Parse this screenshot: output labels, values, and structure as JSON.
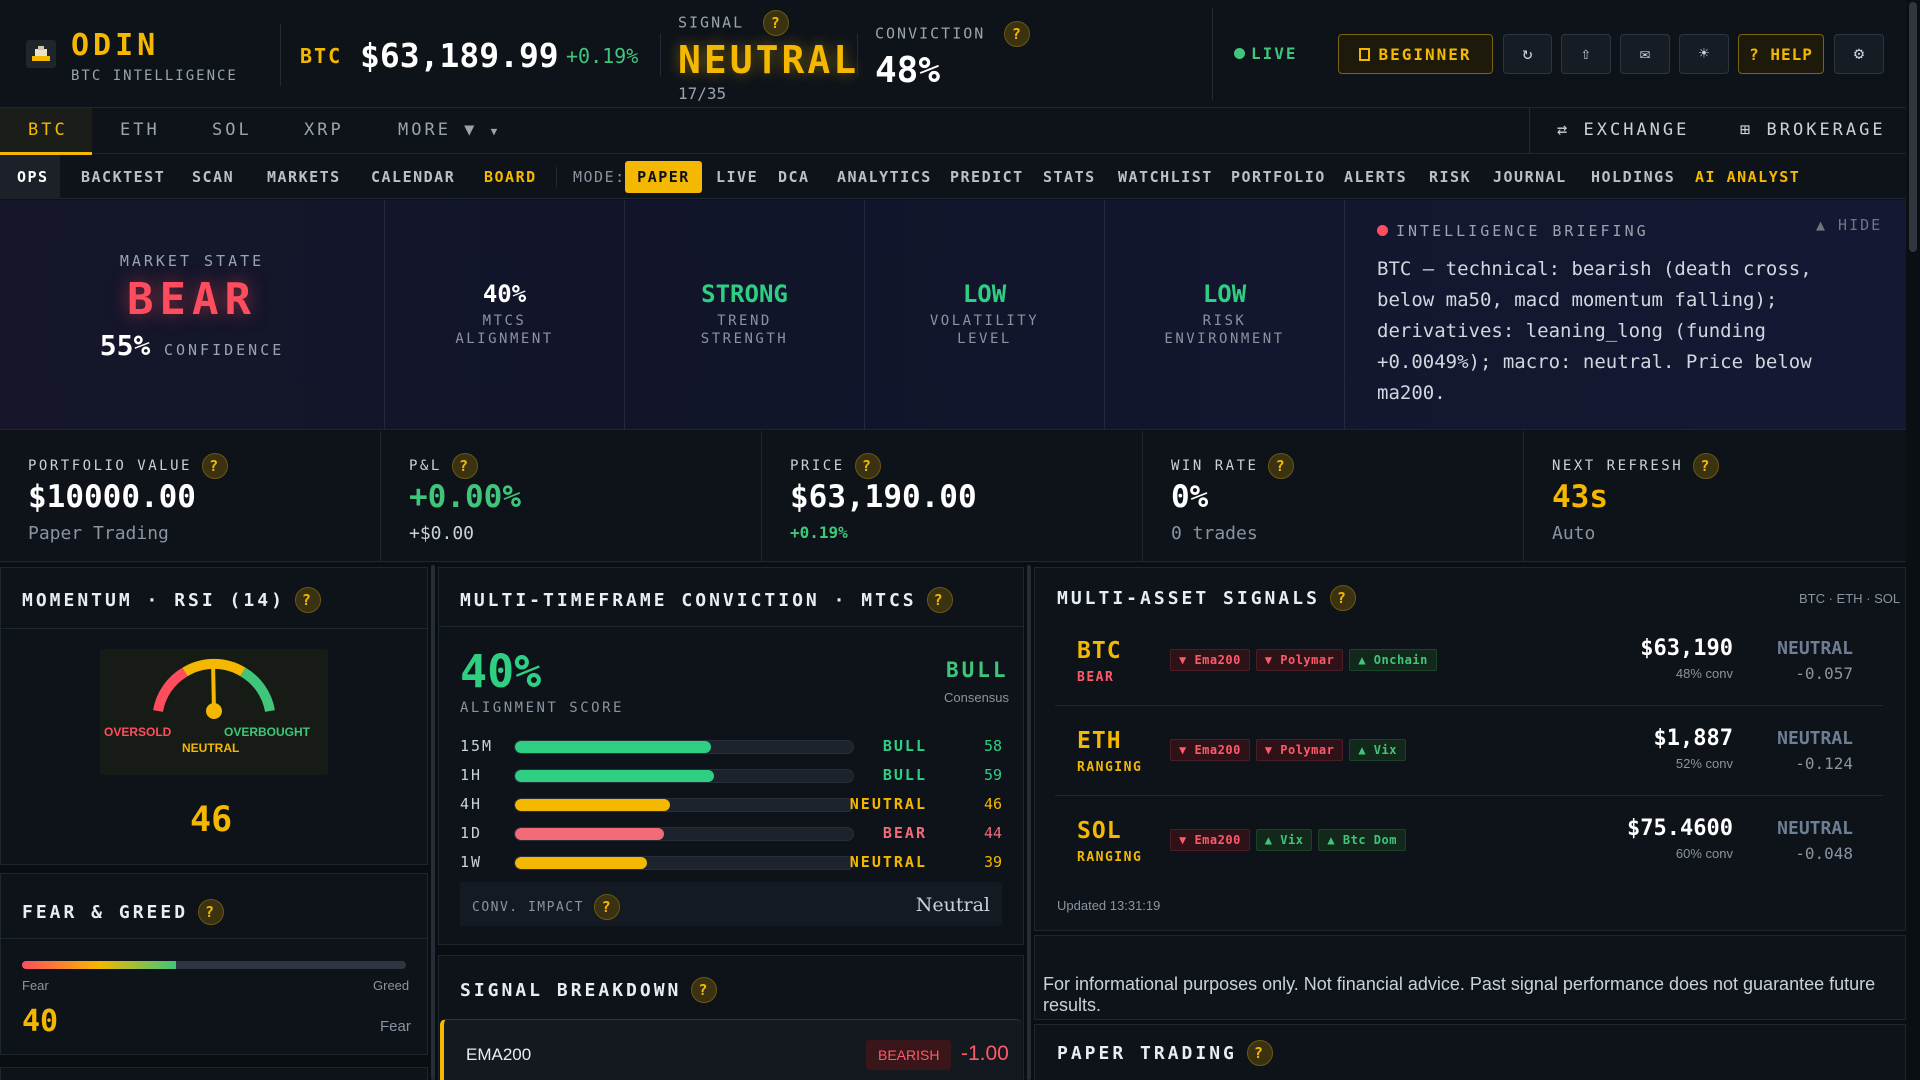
{
  "header": {
    "app_name": "ODIN",
    "app_sub": "BTC INTELLIGENCE",
    "ticker": "BTC",
    "price": "$63,189.99",
    "change": "+0.19%",
    "signal_label": "SIGNAL",
    "signal_value": "NEUTRAL",
    "signal_count": "17/35",
    "conviction_label": "CONVICTION",
    "conviction_value": "48%",
    "live_label": "LIVE",
    "beginner_label": "BEGINNER",
    "help_label": "? HELP",
    "help_q": "?",
    "icons": [
      "refresh-icon",
      "share-icon",
      "mail-icon",
      "theme-icon",
      "gear-icon"
    ]
  },
  "asset_tabs": [
    "BTC",
    "ETH",
    "SOL",
    "XRP",
    "MORE ▼"
  ],
  "right_links": {
    "exchange": "EXCHANGE",
    "brokerage": "BROKERAGE"
  },
  "nav": {
    "items_left": [
      "OPS",
      "BACKTEST",
      "SCAN",
      "MARKETS",
      "CALENDAR",
      "BOARD"
    ],
    "mode_label": "MODE:",
    "mode_active": "PAPER",
    "items_right": [
      "LIVE",
      "DCA",
      "ANALYTICS",
      "PREDICT",
      "STATS",
      "WATCHLIST",
      "PORTFOLIO",
      "ALERTS",
      "RISK",
      "JOURNAL",
      "HOLDINGS",
      "AI ANALYST"
    ]
  },
  "market_state": {
    "label": "MARKET STATE",
    "value": "BEAR",
    "confidence_value": "55%",
    "confidence_label": "CONFIDENCE",
    "metrics": [
      {
        "value": "40%",
        "l1": "MTCS",
        "l2": "ALIGNMENT",
        "color": "#ffffff"
      },
      {
        "value": "STRONG",
        "l1": "TREND",
        "l2": "STRENGTH",
        "color": "#2ecf83"
      },
      {
        "value": "LOW",
        "l1": "VOLATILITY",
        "l2": "LEVEL",
        "color": "#2ecf83"
      },
      {
        "value": "LOW",
        "l1": "RISK",
        "l2": "ENVIRONMENT",
        "color": "#2ecf83"
      }
    ]
  },
  "briefing": {
    "title": "INTELLIGENCE BRIEFING",
    "hide": "▲ HIDE",
    "text": "BTC — technical: bearish (death cross, below ma50, macd momentum falling); derivatives: leaning_long (funding +0.0049%); macro: neutral. Price below ma200."
  },
  "stats": [
    {
      "label": "PORTFOLIO VALUE",
      "value": "$10000.00",
      "sub": "Paper Trading",
      "value_color": "#ffffff",
      "sub_color": "#8a93a0"
    },
    {
      "label": "P&L",
      "value": "+0.00%",
      "sub": "+$0.00",
      "value_color": "#3fc67a",
      "sub_color": "#c9d1d9"
    },
    {
      "label": "PRICE",
      "value": "$63,190.00",
      "sub": "+0.19%",
      "value_color": "#ffffff",
      "sub_color": "#3fc67a"
    },
    {
      "label": "WIN RATE",
      "value": "0%",
      "sub": "0 trades",
      "value_color": "#ffffff",
      "sub_color": "#8a93a0"
    },
    {
      "label": "NEXT REFRESH",
      "value": "43s",
      "sub": "Auto",
      "value_color": "#f5b800",
      "sub_color": "#8a93a0"
    }
  ],
  "rsi": {
    "title": "MOMENTUM · RSI (14)",
    "value": "46",
    "oversold": "OVERSOLD",
    "overbought": "OVERBOUGHT",
    "neutral": "NEUTRAL"
  },
  "fear_greed": {
    "title": "FEAR & GREED",
    "fear": "Fear",
    "greed": "Greed",
    "value": "40",
    "state": "Fear",
    "level": 40
  },
  "mtcs": {
    "title": "MULTI-TIMEFRAME CONVICTION · MTCS",
    "score": "40%",
    "score_label": "ALIGNMENT SCORE",
    "consensus_value": "BULL",
    "consensus_label": "Consensus",
    "rows": [
      {
        "tf": "15M",
        "state": "BULL",
        "value": 58,
        "color": "#2ecf83"
      },
      {
        "tf": "1H",
        "state": "BULL",
        "value": 59,
        "color": "#2ecf83"
      },
      {
        "tf": "4H",
        "state": "NEUTRAL",
        "value": 46,
        "color": "#f5b800"
      },
      {
        "tf": "1D",
        "state": "BEAR",
        "value": 44,
        "color": "#f26b78"
      },
      {
        "tf": "1W",
        "state": "NEUTRAL",
        "value": 39,
        "color": "#f5b800"
      }
    ],
    "impact_label": "CONV. IMPACT",
    "impact_value": "Neutral"
  },
  "multi_asset": {
    "title": "MULTI-ASSET SIGNALS",
    "subtitle": "BTC · ETH · SOL",
    "updated": "Updated 13:31:19",
    "assets": [
      {
        "sym": "BTC",
        "state": "BEAR",
        "state_color": "#ff5a6a",
        "tags": [
          {
            "t": "▼ Ema200",
            "k": "bear"
          },
          {
            "t": "▼ Polymar",
            "k": "bear"
          },
          {
            "t": "▲ Onchain",
            "k": "bull"
          }
        ],
        "price": "$63,190",
        "conv": "48% conv",
        "signal": "NEUTRAL",
        "score": "-0.057"
      },
      {
        "sym": "ETH",
        "state": "RANGING",
        "state_color": "#f5b800",
        "tags": [
          {
            "t": "▼ Ema200",
            "k": "bear"
          },
          {
            "t": "▼ Polymar",
            "k": "bear"
          },
          {
            "t": "▲ Vix",
            "k": "bull"
          }
        ],
        "price": "$1,887",
        "conv": "52% conv",
        "signal": "NEUTRAL",
        "score": "-0.124"
      },
      {
        "sym": "SOL",
        "state": "RANGING",
        "state_color": "#f5b800",
        "tags": [
          {
            "t": "▼ Ema200",
            "k": "bear"
          },
          {
            "t": "▲ Vix",
            "k": "bull"
          },
          {
            "t": "▲ Btc Dom",
            "k": "bull"
          }
        ],
        "price": "$75.4600",
        "conv": "60% conv",
        "signal": "NEUTRAL",
        "score": "-0.048"
      }
    ]
  },
  "disclaimer": "For informational purposes only. Not financial advice. Past signal performance does not guarantee future results.",
  "signal_breakdown": {
    "title": "SIGNAL BREAKDOWN",
    "row": {
      "name": "EMA200",
      "badge": "BEARISH",
      "value": "-1.00"
    }
  },
  "paper_trading": {
    "title": "PAPER TRADING"
  }
}
